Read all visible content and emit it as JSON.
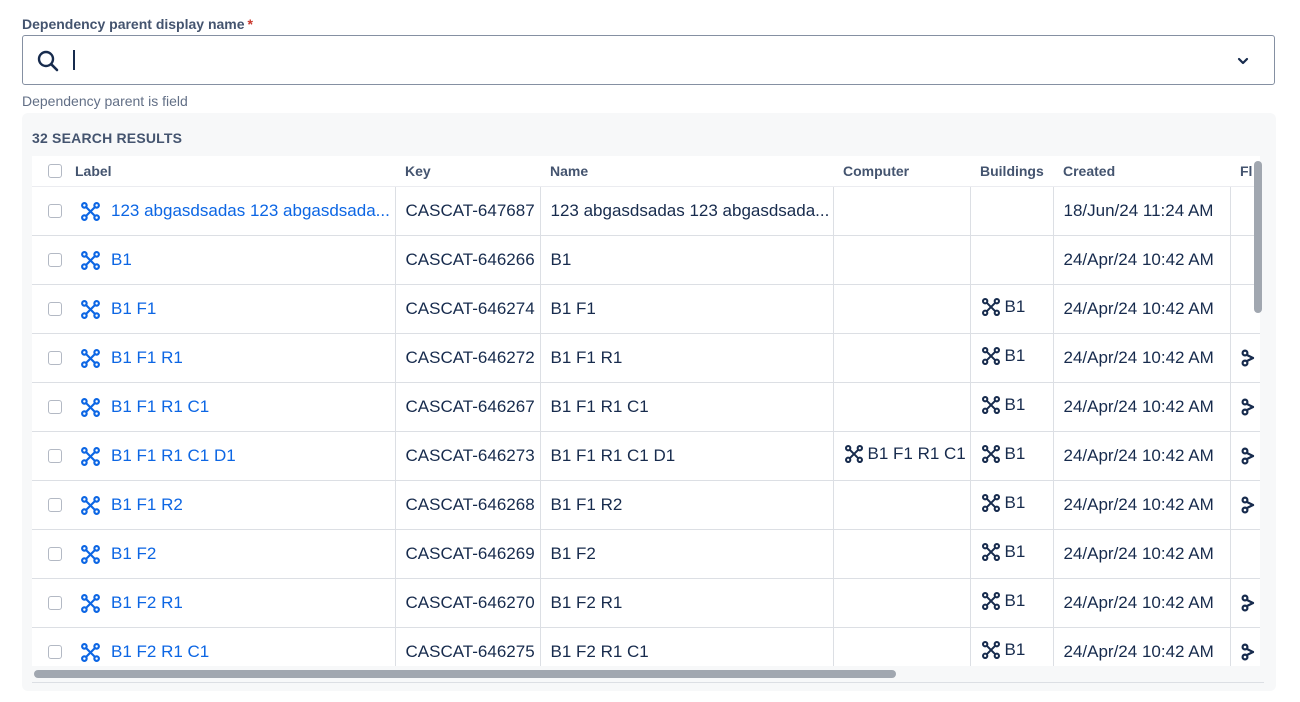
{
  "field": {
    "label": "Dependency parent display name",
    "required_mark": "*",
    "search_value": "",
    "helper": "Dependency parent is field"
  },
  "results": {
    "count_text": "32 SEARCH RESULTS",
    "columns": [
      "Label",
      "Key",
      "Name",
      "Computer",
      "Buildings",
      "Created",
      "Fl"
    ],
    "rows": [
      {
        "label": "123 abgasdsadas 123 abgasdsada...",
        "key": "CASCAT-647687",
        "name": "123 abgasdsadas 123 abgasdsada...",
        "computer": "",
        "buildings": "",
        "created": "18/Jun/24 11:24 AM",
        "fl": false
      },
      {
        "label": "B1",
        "key": "CASCAT-646266",
        "name": "B1",
        "computer": "",
        "buildings": "",
        "created": "24/Apr/24 10:42 AM",
        "fl": false
      },
      {
        "label": "B1 F1",
        "key": "CASCAT-646274",
        "name": "B1 F1",
        "computer": "",
        "buildings": "B1",
        "created": "24/Apr/24 10:42 AM",
        "fl": false
      },
      {
        "label": "B1 F1 R1",
        "key": "CASCAT-646272",
        "name": "B1 F1 R1",
        "computer": "",
        "buildings": "B1",
        "created": "24/Apr/24 10:42 AM",
        "fl": true
      },
      {
        "label": "B1 F1 R1 C1",
        "key": "CASCAT-646267",
        "name": "B1 F1 R1 C1",
        "computer": "",
        "buildings": "B1",
        "created": "24/Apr/24 10:42 AM",
        "fl": true
      },
      {
        "label": "B1 F1 R1 C1 D1",
        "key": "CASCAT-646273",
        "name": "B1 F1 R1 C1 D1",
        "computer": "B1 F1 R1 C1",
        "buildings": "B1",
        "created": "24/Apr/24 10:42 AM",
        "fl": true
      },
      {
        "label": "B1 F1 R2",
        "key": "CASCAT-646268",
        "name": "B1 F1 R2",
        "computer": "",
        "buildings": "B1",
        "created": "24/Apr/24 10:42 AM",
        "fl": true
      },
      {
        "label": "B1 F2",
        "key": "CASCAT-646269",
        "name": "B1 F2",
        "computer": "",
        "buildings": "B1",
        "created": "24/Apr/24 10:42 AM",
        "fl": false
      },
      {
        "label": "B1 F2 R1",
        "key": "CASCAT-646270",
        "name": "B1 F2 R1",
        "computer": "",
        "buildings": "B1",
        "created": "24/Apr/24 10:42 AM",
        "fl": true
      },
      {
        "label": "B1 F2 R1 C1",
        "key": "CASCAT-646275",
        "name": "B1 F2 R1 C1",
        "computer": "",
        "buildings": "B1",
        "created": "24/Apr/24 10:42 AM",
        "fl": true
      }
    ]
  },
  "colors": {
    "link": "#0c66e4",
    "text": "#172b4d",
    "muted": "#44546f",
    "required": "#c9372c",
    "border": "#dcdfe4",
    "panel_bg": "#f7f8f9"
  },
  "icons": {
    "search": "search-icon",
    "dropdown": "chevron-down-icon",
    "object": "object-node-icon"
  }
}
